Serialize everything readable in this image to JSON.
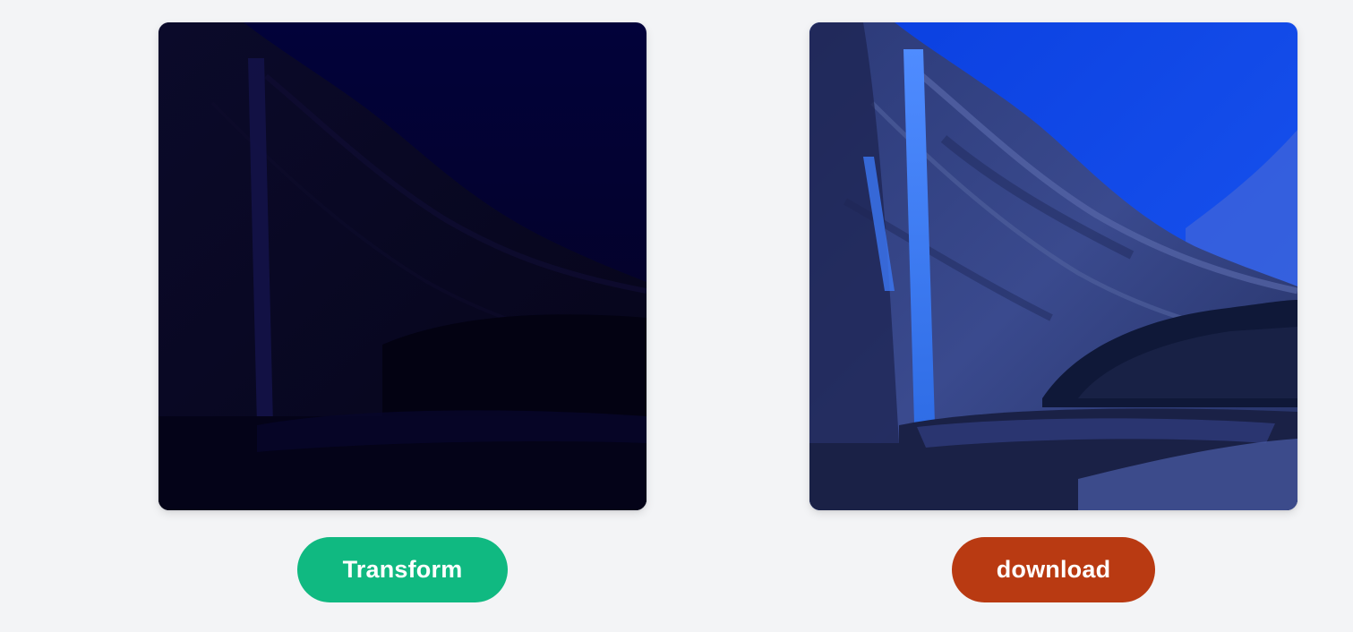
{
  "input_image": {
    "alt": "",
    "style": "dark night photo of canyon waterfall"
  },
  "output_image": {
    "alt": "",
    "style": "enhanced bright blue canyon waterfall"
  },
  "actions": {
    "transform_label": "Transform",
    "download_label": "download"
  },
  "colors": {
    "background": "#f3f4f6",
    "transform_button": "#10b981",
    "download_button": "#b93a12",
    "button_text": "#ffffff"
  }
}
